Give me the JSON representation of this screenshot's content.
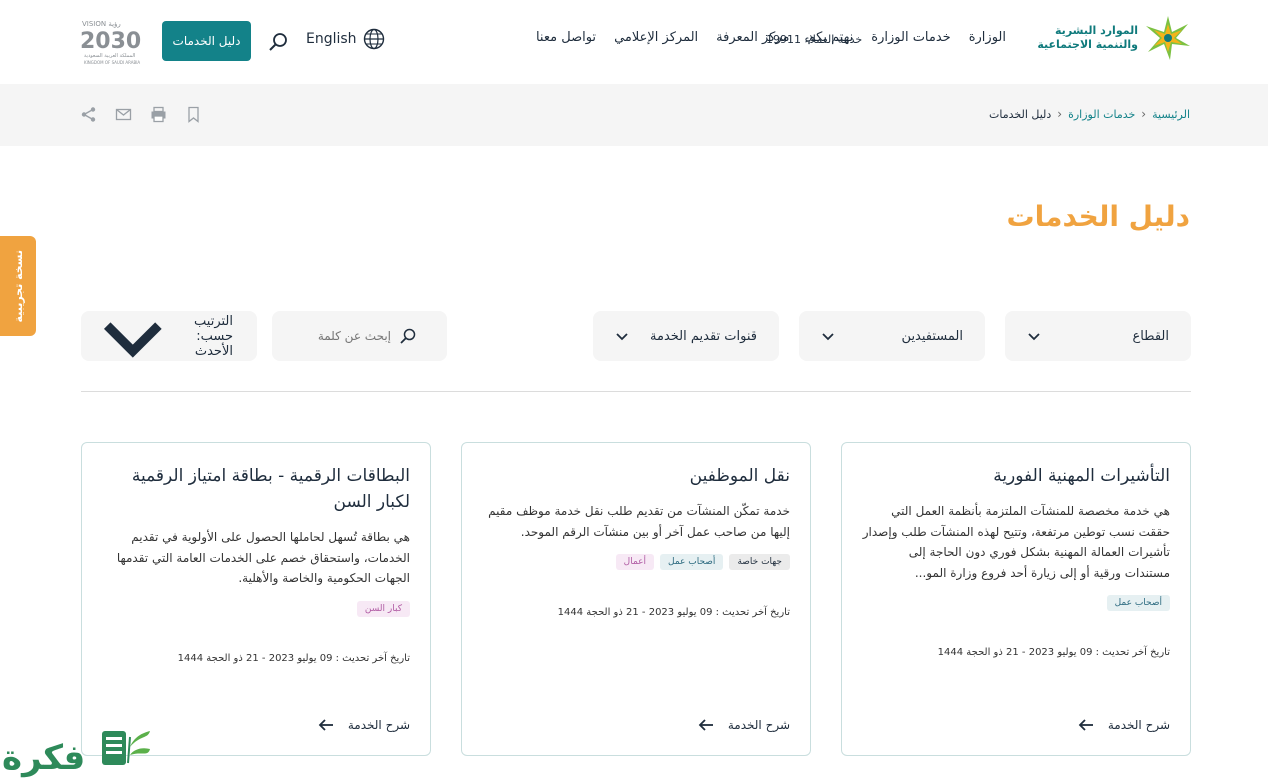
{
  "header": {
    "logo_line1": "الموارد البشرية",
    "logo_line2": "والتنمية الاجتماعية",
    "nav": [
      "الوزارة",
      "خدمات الوزارة",
      "نهتم بكم",
      "مركز المعرفة",
      "المركز الإعلامي",
      "تواصل معنا"
    ],
    "hotline": "خدمة العملاء 19911",
    "language": "English",
    "guide_button": "دليل الخدمات",
    "vision_top": "VISION رؤية",
    "vision_year": "2030",
    "vision_sub": "المملكة العربية السعودية",
    "vision_sub2": "KINGDOM OF SAUDI ARABIA"
  },
  "breadcrumb": {
    "home": "الرئيسية",
    "parent": "خدمات الوزارة",
    "current": "دليل الخدمات"
  },
  "page_title": "دليل الخدمات",
  "side_tab": "نسخة تجريبية",
  "filters": {
    "sector": "القطاع",
    "beneficiaries": "المستفيدين",
    "channels": "قنوات تقديم الخدمة",
    "search_placeholder": "إبحث عن كلمة",
    "sort": "الترتيب حسب: الأحدث"
  },
  "cards": [
    {
      "title": "التأشيرات المهنية الفورية",
      "desc": "هي خدمة مخصصة للمنشآت الملتزمة بأنظمة العمل التي حققت نسب توطين مرتفعة، وتتيح لهذه المنشآت طلب وإصدار تأشيرات العمالة المهنية بشكل فوري دون الحاجة إلى مستندات ورقية أو إلى زيارة أحد فروع وزارة المو...",
      "tags": [
        {
          "label": "أصحاب عمل",
          "style": "teal"
        }
      ],
      "date": "تاريخ آخر تحديث : 09 يوليو 2023 - 21 ذو الحجة 1444",
      "link": "شرح الخدمة"
    },
    {
      "title": "نقل الموظفين",
      "desc": "خدمة تمكّن المنشآت من تقديم طلب نقل خدمة موظف مقيم إليها من صاحب عمل آخر أو بين منشآت الرقم الموحد.",
      "tags": [
        {
          "label": "جهات خاصة",
          "style": "gray"
        },
        {
          "label": "أصحاب عمل",
          "style": "teal"
        },
        {
          "label": "أعمال",
          "style": "pink"
        }
      ],
      "date": "تاريخ آخر تحديث : 09 يوليو 2023 - 21 ذو الحجة 1444",
      "link": "شرح الخدمة"
    },
    {
      "title": "البطاقات الرقمية - بطاقة امتياز الرقمية لكبار السن",
      "desc": "هي بطاقة تُسهل لحاملها الحصول على الأولوية في تقديم الخدمات، واستحقاق خصم على الخدمات العامة التي تقدمها الجهات الحكومية والخاصة والأهلية.",
      "tags": [
        {
          "label": "كبار السن",
          "style": "pink"
        }
      ],
      "date": "تاريخ آخر تحديث : 09 يوليو 2023 - 21 ذو الحجة 1444",
      "link": "شرح الخدمة"
    }
  ],
  "watermark": "فكرة",
  "colors": {
    "primary": "#138289",
    "accent": "#f0a340",
    "text": "#1f2d3d"
  }
}
